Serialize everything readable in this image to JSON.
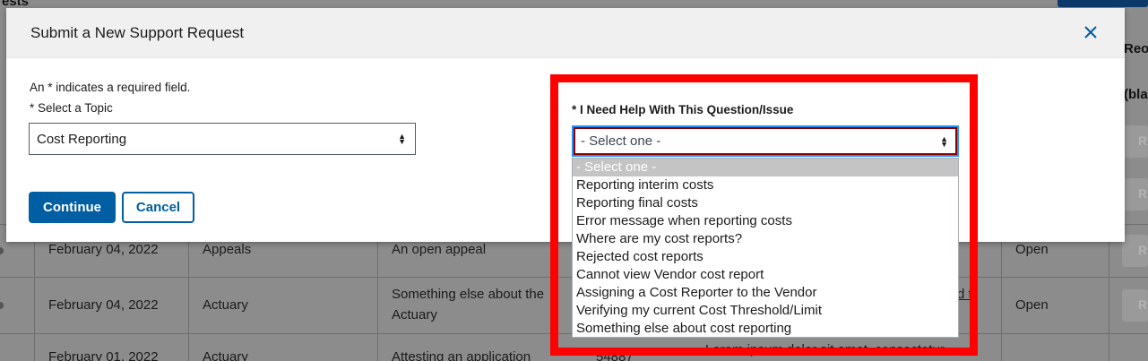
{
  "background": {
    "page_title_fragment": "ests",
    "column_headers": [
      "Reo",
      "(bla"
    ],
    "rows": [
      {
        "date": "February 04, 2022",
        "topic": "Appeals",
        "description": "An open appeal",
        "number": "",
        "detail": "",
        "status": "Open",
        "action": "R"
      },
      {
        "date": "February 04, 2022",
        "topic": "Actuary",
        "description": "Something else about the Actuary",
        "number": "",
        "detail": "d t",
        "status": "Open",
        "action": "R"
      },
      {
        "date": "February 01, 2022",
        "topic": "Actuary",
        "description": "Attesting an application",
        "number": "54887",
        "detail": "Lorem ipsum dolor sit amet, consectetur",
        "status": "",
        "action": ""
      }
    ],
    "side_buttons": [
      "R",
      "R",
      "R",
      "R",
      "R"
    ]
  },
  "modal": {
    "title": "Submit a New Support Request",
    "close_icon": "close-icon",
    "required_note": "An * indicates a required field.",
    "topic_label": "* Select a Topic",
    "topic_value": "Cost Reporting",
    "continue_label": "Continue",
    "cancel_label": "Cancel",
    "help_label": "* I Need Help With This Question/Issue",
    "help_value": "- Select one -",
    "help_options": [
      "- Select one -",
      "Reporting interim costs",
      "Reporting final costs",
      "Error message when reporting costs",
      "Where are my cost reports?",
      "Rejected cost reports",
      "Cannot view Vendor cost report",
      "Assigning a Cost Reporter to the Vendor",
      "Verifying my current Cost Threshold/Limit",
      "Something else about cost reporting"
    ]
  },
  "colors": {
    "primary": "#005ea2",
    "highlight": "#ff0000",
    "overlay": "#8c8c8c"
  }
}
